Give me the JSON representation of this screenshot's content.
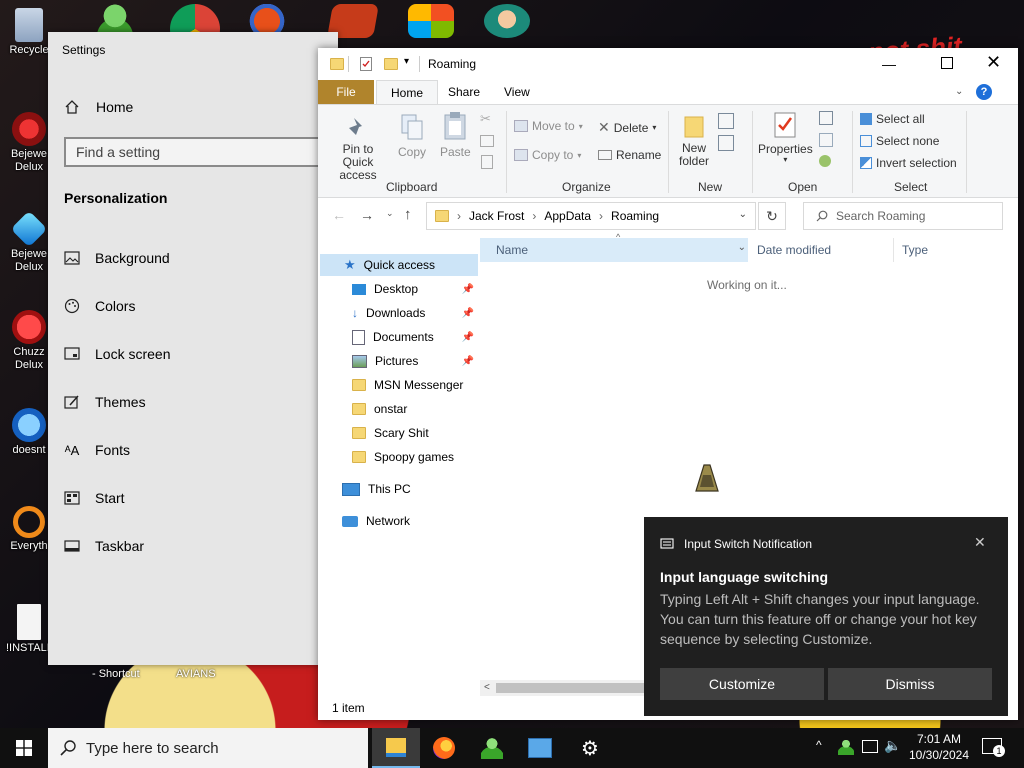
{
  "desktop": {
    "icons": [
      "Recycle",
      "Bejewe Delux",
      "Bejewe Delux",
      "Chuzz Delux",
      "doesnt",
      "Everyth",
      "!INSTALL"
    ],
    "shortcut_labels": [
      "- Shortcut",
      "AVIANS"
    ],
    "background_text": "not shit"
  },
  "settings": {
    "title": "Settings",
    "home": "Home",
    "find_placeholder": "Find a setting",
    "section": "Personalization",
    "items": [
      "Background",
      "Colors",
      "Lock screen",
      "Themes",
      "Fonts",
      "Start",
      "Taskbar"
    ]
  },
  "explorer": {
    "title": "Roaming",
    "tabs": [
      "File",
      "Home",
      "Share",
      "View"
    ],
    "ribbon": {
      "clipboard": {
        "pin": "Pin to Quick access",
        "copy": "Copy",
        "paste": "Paste",
        "label": "Clipboard"
      },
      "organize": {
        "move_to": "Move to",
        "copy_to": "Copy to",
        "delete": "Delete",
        "rename": "Rename",
        "label": "Organize"
      },
      "new": {
        "new_folder": "New folder",
        "label": "New"
      },
      "open": {
        "properties": "Properties",
        "label": "Open"
      },
      "select": {
        "select_all": "Select all",
        "select_none": "Select none",
        "invert": "Invert selection",
        "label": "Select"
      }
    },
    "breadcrumb": [
      "Jack Frost",
      "AppData",
      "Roaming"
    ],
    "search_placeholder": "Search Roaming",
    "columns": [
      "Name",
      "Date modified",
      "Type"
    ],
    "working": "Working on it...",
    "nav": {
      "quick_access": "Quick access",
      "pinned": [
        "Desktop",
        "Downloads",
        "Documents",
        "Pictures"
      ],
      "folders": [
        "MSN Messenger",
        "onstar",
        "Scary Shit",
        "Spoopy games"
      ],
      "this_pc": "This PC",
      "network": "Network"
    },
    "status": "1 item"
  },
  "notification": {
    "app": "Input Switch Notification",
    "heading": "Input language switching",
    "body": "Typing Left Alt + Shift changes your input language. You can turn this feature off or change your hot key sequence by selecting Customize.",
    "customize": "Customize",
    "dismiss": "Dismiss"
  },
  "taskbar": {
    "search_placeholder": "Type here to search",
    "time": "7:01 AM",
    "date": "10/30/2024",
    "notification_count": "1"
  },
  "colors": {
    "file_tab": "#b0842c",
    "accent": "#0078d7",
    "toast_bg": "#1f1f1f"
  }
}
